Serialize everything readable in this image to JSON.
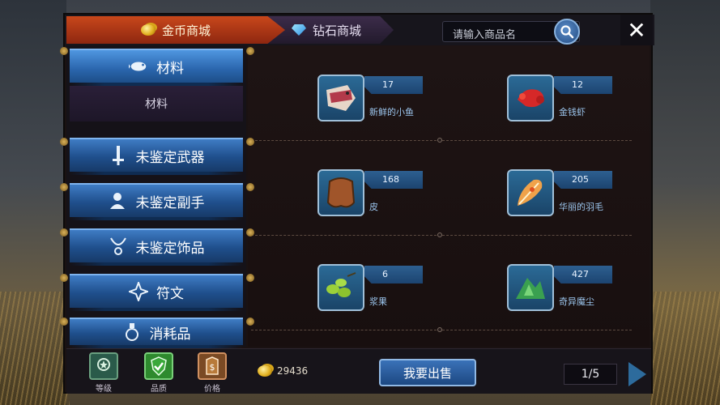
{
  "tabs": [
    {
      "label": "金币商城",
      "icon": "coin-icon",
      "active": true
    },
    {
      "label": "钻石商城",
      "icon": "diamond-icon",
      "active": false
    }
  ],
  "search": {
    "placeholder": "请输入商品名"
  },
  "sidebar": {
    "active_category": {
      "label": "材料",
      "icon": "fish-bone-icon"
    },
    "subcategory": "材料",
    "categories": [
      {
        "label": "未鉴定武器",
        "icon": "sword-icon"
      },
      {
        "label": "未鉴定副手",
        "icon": "person-icon"
      },
      {
        "label": "未鉴定饰品",
        "icon": "necklace-icon"
      },
      {
        "label": "符文",
        "icon": "rune-star-icon"
      },
      {
        "label": "消耗品",
        "icon": "potion-icon"
      }
    ]
  },
  "items": [
    {
      "name": "新鲜的小鱼",
      "qty": "17",
      "icon": "fish-icon"
    },
    {
      "name": "金钱虾",
      "qty": "12",
      "icon": "shrimp-icon"
    },
    {
      "name": "皮",
      "qty": "168",
      "icon": "leather-icon"
    },
    {
      "name": "华丽的羽毛",
      "qty": "205",
      "icon": "feather-icon"
    },
    {
      "name": "浆果",
      "qty": "6",
      "icon": "berry-icon"
    },
    {
      "name": "奇异魔尘",
      "qty": "427",
      "icon": "magic-dust-icon"
    }
  ],
  "bottom": {
    "filters": [
      {
        "label": "等级",
        "icon": "level-medal-icon"
      },
      {
        "label": "品质",
        "icon": "quality-shield-icon"
      },
      {
        "label": "价格",
        "icon": "price-tag-icon"
      }
    ],
    "gold": "29436",
    "sell_label": "我要出售",
    "page": "1/5"
  },
  "colors": {
    "tab_active": "#c8471b",
    "button_blue": "#2a65ac",
    "panel_bg": "#1a1212"
  }
}
